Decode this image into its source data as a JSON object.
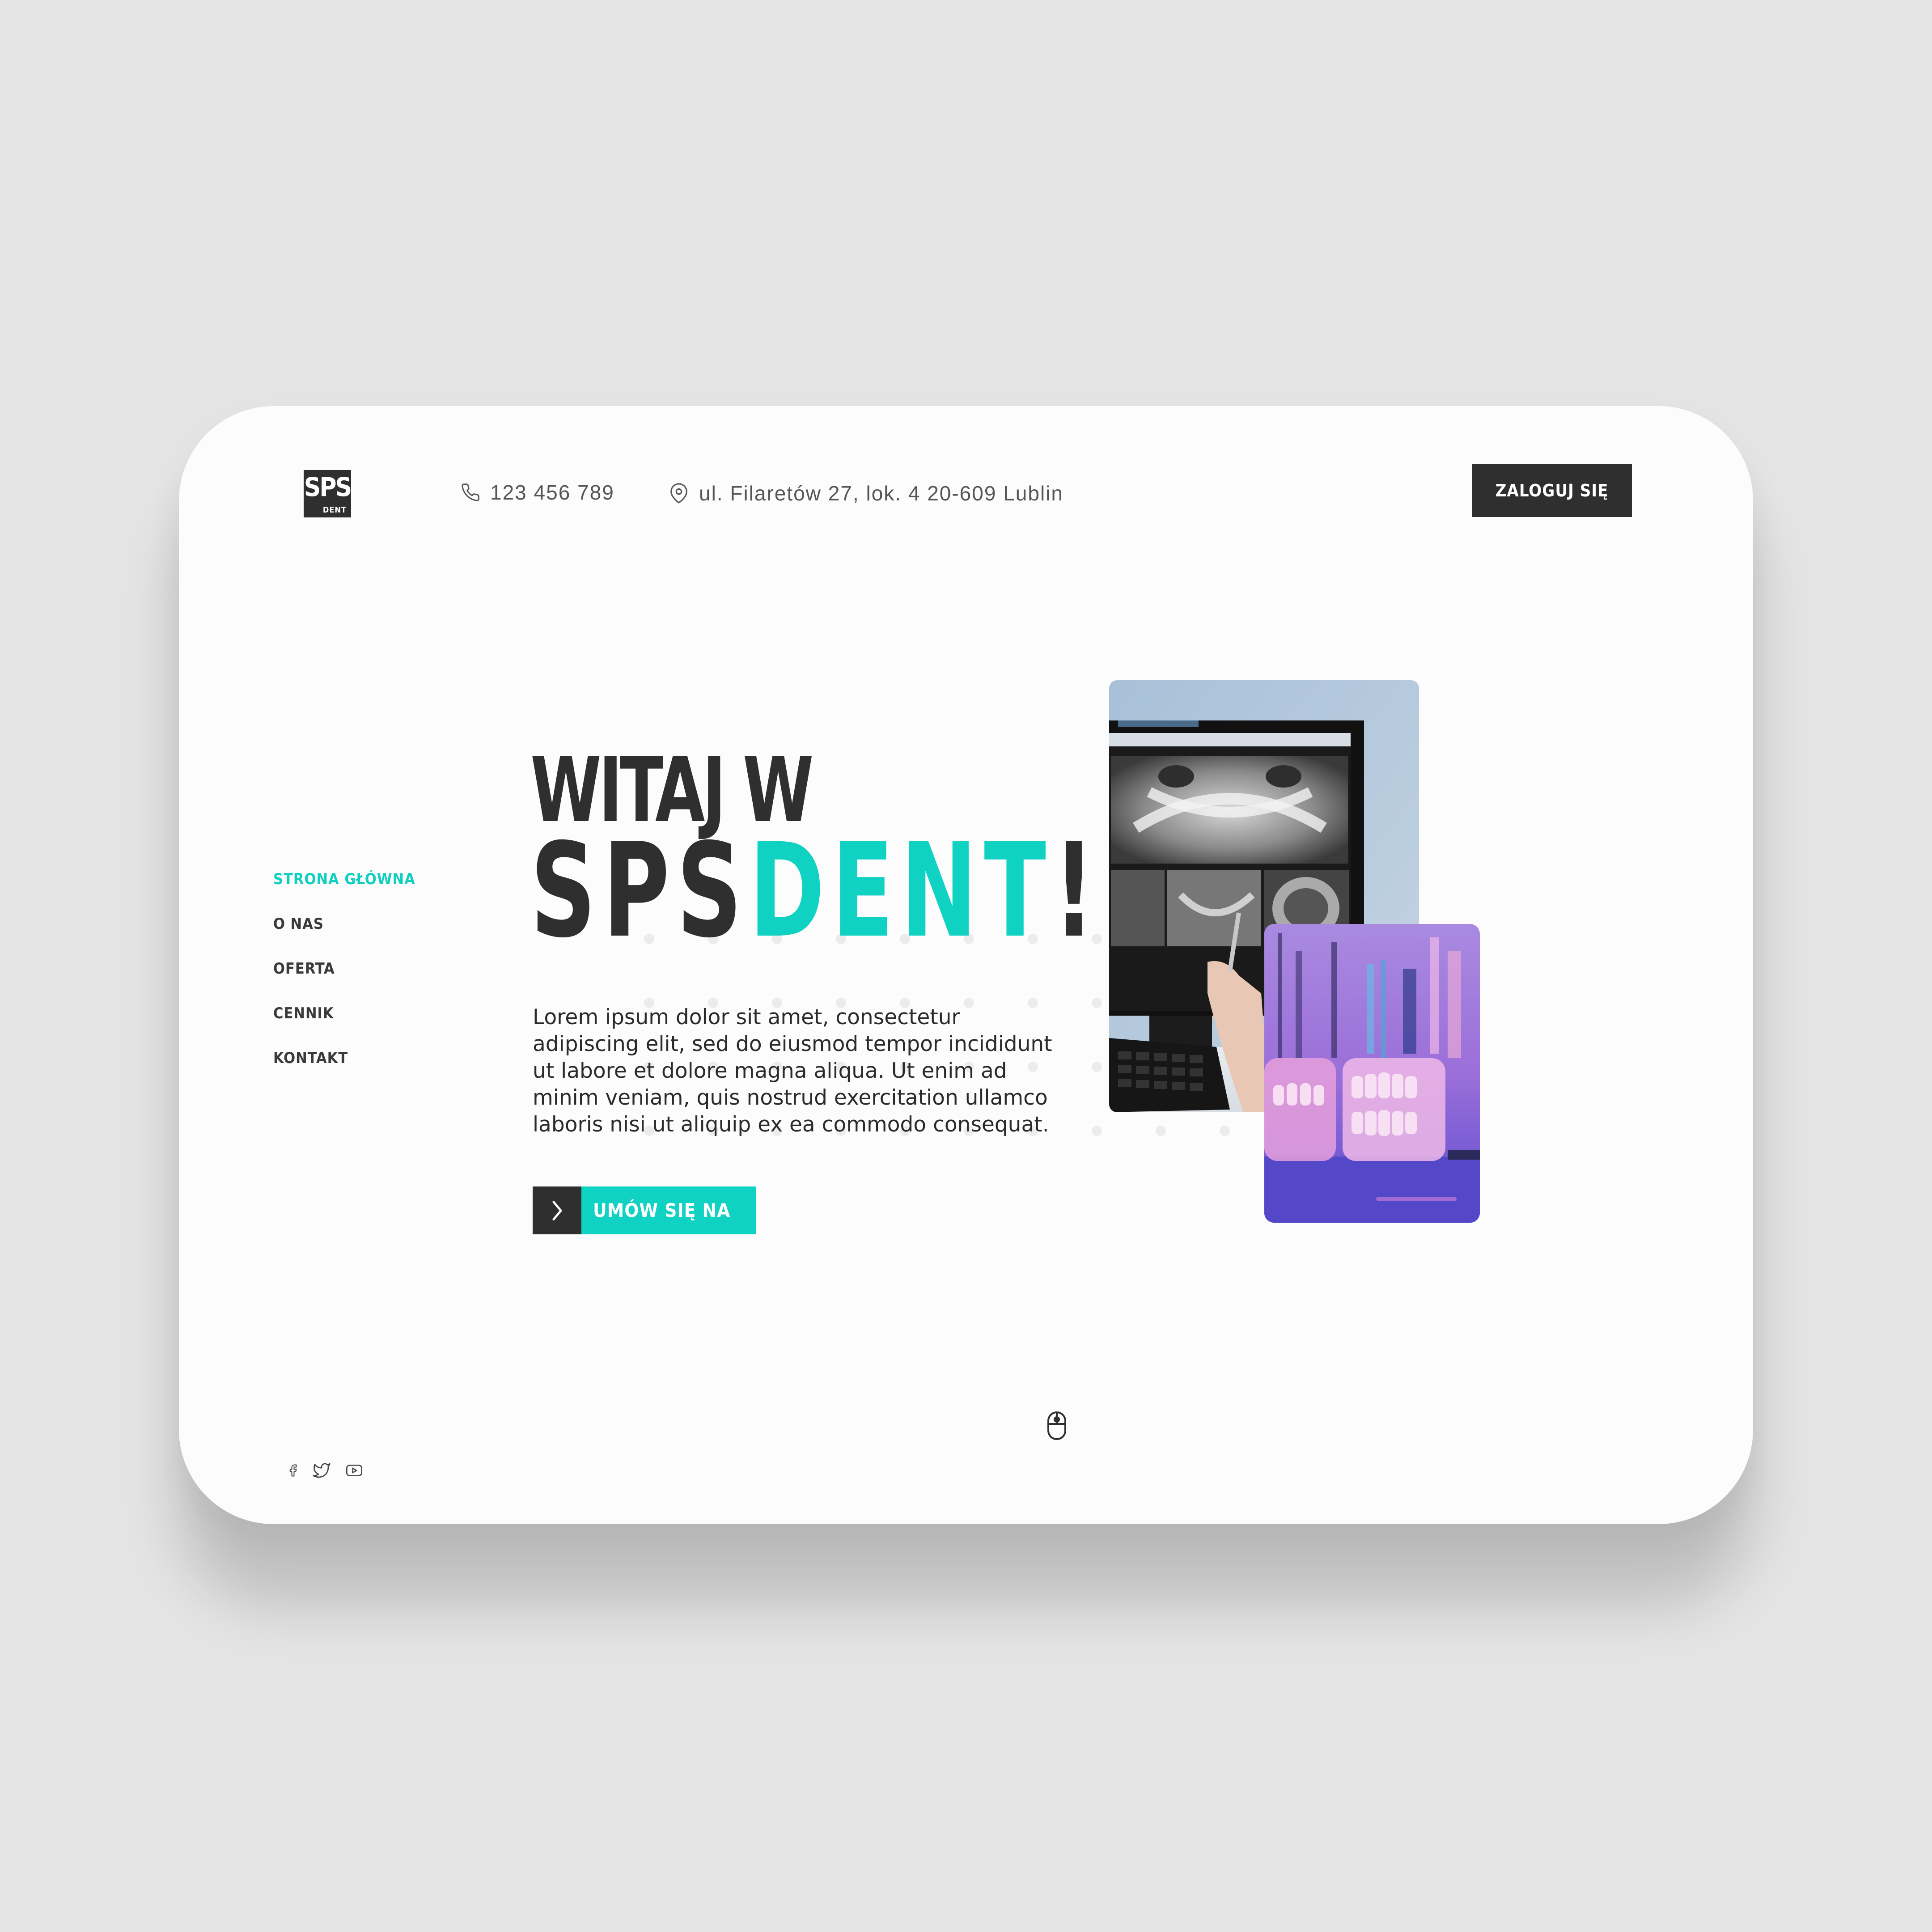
{
  "brand": {
    "logo_main": "SPS",
    "logo_sub": "DENT"
  },
  "header": {
    "phone": "123 456 789",
    "address": "ul. Filaretów 27, lok. 4  20-609 Lublin",
    "login_label": "ZALOGUJ SIĘ"
  },
  "nav": {
    "items": [
      {
        "label": "STRONA GŁÓWNA",
        "active": true
      },
      {
        "label": "O NAS"
      },
      {
        "label": "OFERTA"
      },
      {
        "label": "CENNIK"
      },
      {
        "label": "KONTAKT"
      }
    ]
  },
  "hero": {
    "line1": "WITAJ W",
    "line2_dark": "SPS",
    "line2_accent": "DENT",
    "line2_end": "!",
    "description": "Lorem ipsum dolor sit amet, consectetur adipiscing elit, sed do eiusmod tempor incididunt ut labore et dolore magna aliqua. Ut enim ad minim veniam, quis nostrud exercitation ullamco laboris nisi ut aliquip ex ea commodo consequat.",
    "cta_label": "UMÓW SIĘ NA"
  },
  "colors": {
    "accent": "#10d2c2",
    "dark": "#2f2f2f",
    "background": "#e4e4e4",
    "card": "#fcfcfc"
  },
  "icons": {
    "phone": "phone-icon",
    "address": "map-pin-icon",
    "cta": "chevron-right-icon",
    "scroll": "mouse-icon",
    "social": [
      "facebook-icon",
      "twitter-icon",
      "youtube-icon"
    ]
  }
}
